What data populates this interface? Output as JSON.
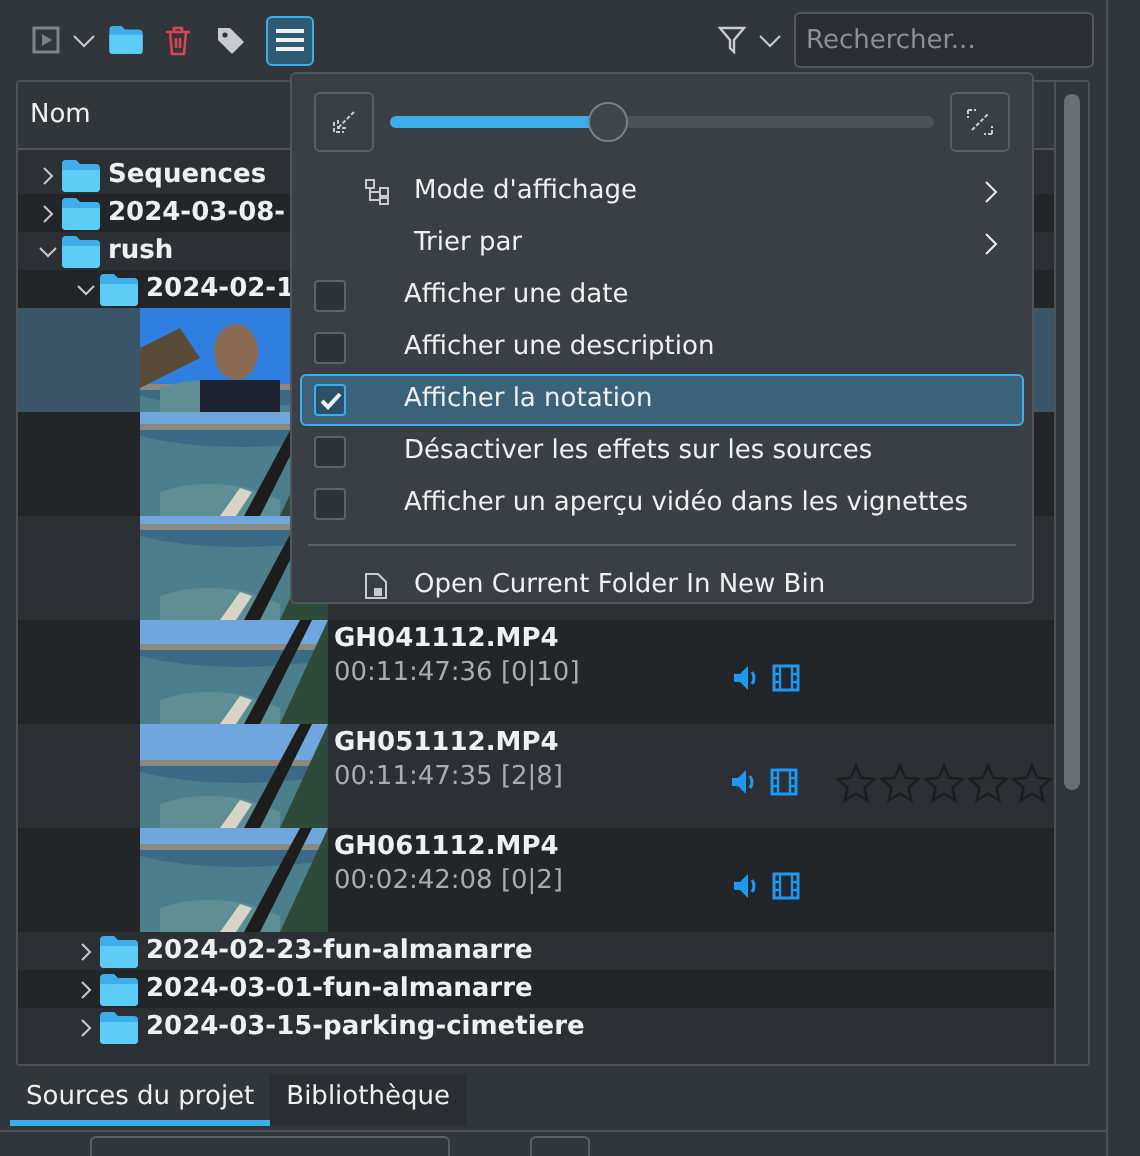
{
  "toolbar": {
    "search": {
      "placeholder": "Rechercher..."
    },
    "menu_button": {
      "pressed": true
    }
  },
  "tree": {
    "header": "Nom",
    "items": [
      {
        "kind": "folder",
        "name": "Sequences",
        "expanded": false
      },
      {
        "kind": "folder",
        "name": "2024-03-08-",
        "expanded": false
      },
      {
        "kind": "folder",
        "name": "rush",
        "expanded": true,
        "children": [
          {
            "kind": "folder",
            "name": "2024-02-1",
            "expanded": true,
            "children": [
              {
                "kind": "clip",
                "selected": true
              },
              {
                "kind": "clip",
                "selected": false
              },
              {
                "kind": "clip",
                "selected": false
              },
              {
                "kind": "clip",
                "selected": false,
                "name": "GH041112.MP4",
                "timecode": "00:11:47:36 [0|10]"
              },
              {
                "kind": "clip",
                "selected": false,
                "name": "GH051112.MP4",
                "timecode": "00:11:47:35 [2|8]",
                "stars": 0
              },
              {
                "kind": "clip",
                "selected": false,
                "name": "GH061112.MP4",
                "timecode": "00:02:42:08 [0|2]"
              }
            ]
          },
          {
            "kind": "folder",
            "name": "2024-02-23-fun-almanarre",
            "expanded": false
          },
          {
            "kind": "folder",
            "name": "2024-03-01-fun-almanarre",
            "expanded": false
          },
          {
            "kind": "folder",
            "name": "2024-03-15-parking-cimetiere",
            "expanded": false
          }
        ]
      }
    ]
  },
  "menu": {
    "zoom": {
      "level": 0.4
    },
    "items": [
      {
        "kind": "submenu",
        "label": "Mode d'affichage",
        "has_icon": true
      },
      {
        "kind": "submenu",
        "label": "Trier par",
        "has_icon": false
      },
      {
        "kind": "checkbox",
        "label": "Afficher une date",
        "checked": false,
        "selected": false
      },
      {
        "kind": "checkbox",
        "label": "Afficher une description",
        "checked": false,
        "selected": false
      },
      {
        "kind": "checkbox",
        "label": "Afficher la notation",
        "checked": true,
        "selected": true
      },
      {
        "kind": "checkbox",
        "label": "Désactiver les effets sur les sources",
        "checked": false,
        "selected": false
      },
      {
        "kind": "checkbox",
        "label": "Afficher un aperçu vidéo dans les vignettes",
        "checked": false,
        "selected": false
      },
      {
        "kind": "separator"
      },
      {
        "kind": "action",
        "label": "Open Current Folder In New Bin",
        "has_icon": true
      }
    ]
  },
  "tabs": [
    {
      "label": "Sources du projet",
      "selected": true
    },
    {
      "label": "Bibliothèque",
      "selected": false
    }
  ]
}
